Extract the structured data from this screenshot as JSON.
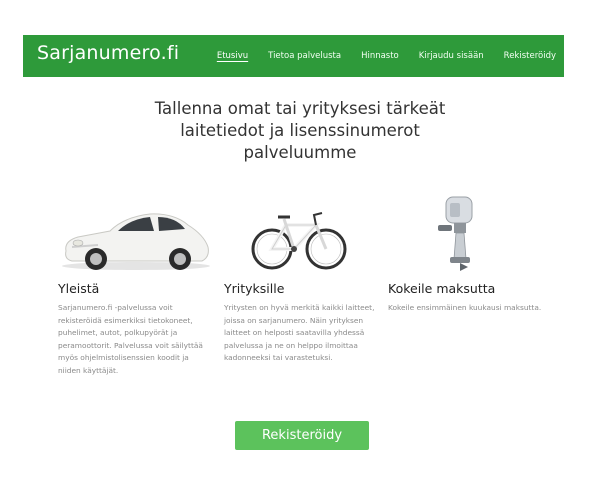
{
  "header": {
    "brand": "Sarjanumero.fi",
    "nav": [
      {
        "label": "Etusivu",
        "active": true
      },
      {
        "label": "Tietoa palvelusta"
      },
      {
        "label": "Hinnasto"
      },
      {
        "label": "Kirjaudu sisään"
      },
      {
        "label": "Rekisteröidy"
      }
    ]
  },
  "hero": {
    "line1": "Tallenna omat tai yrityksesi tärkeät",
    "line2": "laitetiedot ja lisenssinumerot",
    "line3": "palveluumme"
  },
  "features": [
    {
      "icon": "car-image",
      "title": "Yleistä",
      "text": "Sarjanumero.fi -palvelussa voit rekisteröidä esimerkiksi tietokoneet, puhelimet, autot, polkupyörät ja peramoottorit. Palvelussa voit säilyttää myös ohjelmistolisenssien koodit ja niiden käyttäjät."
    },
    {
      "icon": "bicycle-image",
      "title": "Yrityksille",
      "text": "Yritysten on hyvä merkitä kaikki laitteet, joissa on sarjanumero. Näin yrityksen laitteet on helposti saatavilla yhdessä palvelussa ja ne on helppo ilmoittaa kadonneeksi tai varastetuksi."
    },
    {
      "icon": "outboard-motor-image",
      "title": "Kokeile maksutta",
      "text": "Kokeile ensimmäinen kuukausi maksutta."
    }
  ],
  "cta": {
    "label": "Rekisteröidy"
  },
  "colors": {
    "navbar": "#2e9a3a",
    "button": "#5cc25c"
  }
}
